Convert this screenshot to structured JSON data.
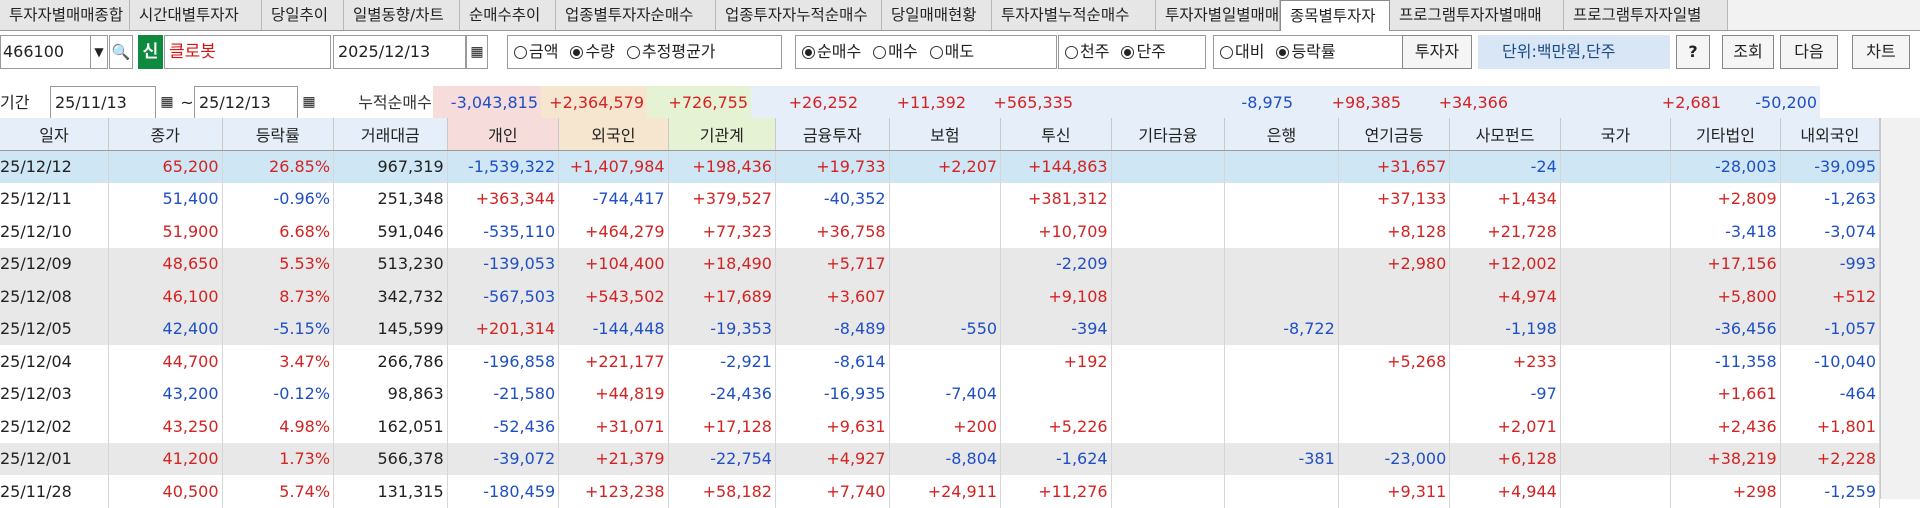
{
  "tabs": [
    "투자자별매매종합",
    "시간대별투자자",
    "당일추이",
    "일별동향/차트",
    "순매수추이",
    "업종별투자자순매수",
    "업종투자자누적순매수",
    "당일매매현황",
    "투자자별누적순매수",
    "투자자별일별매매",
    "종목별투자자",
    "프로그램투자자별매매",
    "프로그램투자자일별"
  ],
  "active_tab": "종목별투자자",
  "toolbar": {
    "code": "466100",
    "new_badge": "신",
    "stock_name": "클로봇",
    "date": "2025/12/13",
    "radio_group_1": [
      {
        "label": "금액",
        "selected": false
      },
      {
        "label": "수량",
        "selected": true
      },
      {
        "label": "추정평균가",
        "selected": false
      }
    ],
    "radio_group_2": [
      {
        "label": "순매수",
        "selected": true
      },
      {
        "label": "매수",
        "selected": false
      },
      {
        "label": "매도",
        "selected": false
      }
    ],
    "radio_group_3": [
      {
        "label": "천주",
        "selected": false
      },
      {
        "label": "단주",
        "selected": true
      }
    ],
    "radio_group_4": [
      {
        "label": "대비",
        "selected": false
      },
      {
        "label": "등락률",
        "selected": true
      }
    ],
    "investor_button": "투자자",
    "unit_label": "단위:백만원,단주",
    "help_button": "?",
    "query_button": "조회",
    "next_button": "다음",
    "chart_button": "차트"
  },
  "period": {
    "label": "기간",
    "from": "25/11/13",
    "tilde": "~",
    "to": "25/12/13",
    "cumulative_label": "누적순매수",
    "sums": [
      "-3,043,815",
      "+2,364,579",
      "+726,755",
      "+26,252",
      "+11,392",
      "+565,335",
      "",
      "-8,975",
      "+98,385",
      "+34,366",
      "",
      "+2,681",
      "-50,200"
    ]
  },
  "columns": [
    "일자",
    "종가",
    "등락률",
    "거래대금",
    "개인",
    "외국인",
    "기관계",
    "금융투자",
    "보험",
    "투신",
    "기타금융",
    "은행",
    "연기금등",
    "사모펀드",
    "국가",
    "기타법인",
    "내외국인"
  ],
  "rows": [
    [
      "25/12/12",
      "65,200",
      "26.85%",
      "967,319",
      "-1,539,322",
      "+1,407,984",
      "+198,436",
      "+19,733",
      "+2,207",
      "+144,863",
      "",
      "",
      "+31,657",
      "-24",
      "",
      "-28,003",
      "-39,095"
    ],
    [
      "25/12/11",
      "51,400",
      "-0.96%",
      "251,348",
      "+363,344",
      "-744,417",
      "+379,527",
      "-40,352",
      "",
      "+381,312",
      "",
      "",
      "+37,133",
      "+1,434",
      "",
      "+2,809",
      "-1,263"
    ],
    [
      "25/12/10",
      "51,900",
      "6.68%",
      "591,046",
      "-535,110",
      "+464,279",
      "+77,323",
      "+36,758",
      "",
      "+10,709",
      "",
      "",
      "+8,128",
      "+21,728",
      "",
      "-3,418",
      "-3,074"
    ],
    [
      "25/12/09",
      "48,650",
      "5.53%",
      "513,230",
      "-139,053",
      "+104,400",
      "+18,490",
      "+5,717",
      "",
      "-2,209",
      "",
      "",
      "+2,980",
      "+12,002",
      "",
      "+17,156",
      "-993"
    ],
    [
      "25/12/08",
      "46,100",
      "8.73%",
      "342,732",
      "-567,503",
      "+543,502",
      "+17,689",
      "+3,607",
      "",
      "+9,108",
      "",
      "",
      "",
      "+4,974",
      "",
      "+5,800",
      "+512"
    ],
    [
      "25/12/05",
      "42,400",
      "-5.15%",
      "145,599",
      "+201,314",
      "-144,448",
      "-19,353",
      "-8,489",
      "-550",
      "-394",
      "",
      "-8,722",
      "",
      "-1,198",
      "",
      "-36,456",
      "-1,057"
    ],
    [
      "25/12/04",
      "44,700",
      "3.47%",
      "266,786",
      "-196,858",
      "+221,177",
      "-2,921",
      "-8,614",
      "",
      "+192",
      "",
      "",
      "+5,268",
      "+233",
      "",
      "-11,358",
      "-10,040"
    ],
    [
      "25/12/03",
      "43,200",
      "-0.12%",
      "98,863",
      "-21,580",
      "+44,819",
      "-24,436",
      "-16,935",
      "-7,404",
      "",
      "",
      "",
      "",
      "-97",
      "",
      "+1,661",
      "-464"
    ],
    [
      "25/12/02",
      "43,250",
      "4.98%",
      "162,051",
      "-52,436",
      "+31,071",
      "+17,128",
      "+9,631",
      "+200",
      "+5,226",
      "",
      "",
      "",
      "+2,071",
      "",
      "+2,436",
      "+1,801"
    ],
    [
      "25/12/01",
      "41,200",
      "1.73%",
      "566,378",
      "-39,072",
      "+21,379",
      "-22,754",
      "+4,927",
      "-8,804",
      "-1,624",
      "",
      "-381",
      "-23,000",
      "+6,128",
      "",
      "+38,219",
      "+2,228"
    ],
    [
      "25/11/28",
      "40,500",
      "5.74%",
      "131,315",
      "-180,459",
      "+123,238",
      "+58,182",
      "+7,740",
      "+24,911",
      "+11,276",
      "",
      "",
      "+9,311",
      "+4,944",
      "",
      "+298",
      "-1,259"
    ]
  ],
  "row_styles": [
    "sel",
    "",
    "",
    "alt",
    "alt",
    "alt",
    "",
    "",
    "",
    "alt",
    ""
  ],
  "colors": {
    "positive": "#d32323",
    "negative": "#1f4fc4",
    "header_bg": "#e6eef9",
    "personal_bg": "#f7dcdc",
    "foreign_bg": "#f6e6cf",
    "inst_bg": "#e6f2d4",
    "selected_row": "#cfe6f4",
    "alt_row": "#e8e8e8",
    "new_badge": "#0e8a3f",
    "unit_bg": "#d8e6f5"
  }
}
